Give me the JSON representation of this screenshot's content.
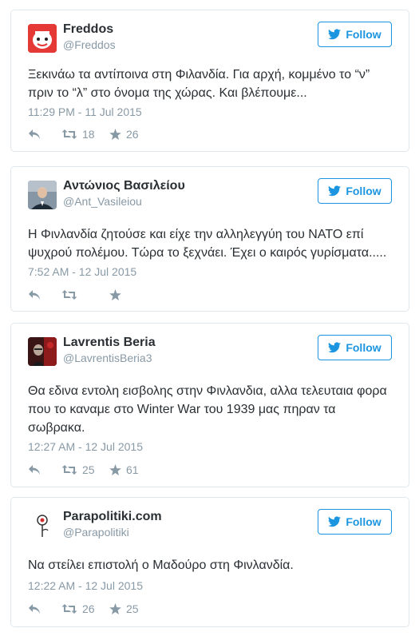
{
  "follow_label": "Follow",
  "tweets": [
    {
      "name": "Freddos",
      "handle": "@Freddos",
      "text_lines": [
        "Ξεκινάω τα αντίποινα στη Φιλανδία. Για αρχή, κομμένο το “ν”",
        "πριν το “λ” στο όνομα της χώρας. Και βλέπουμε..."
      ],
      "date": "11:29 PM - 11 Jul 2015",
      "retweets": "18",
      "likes": "26"
    },
    {
      "name": "Αντώνιος Βασιλείου",
      "handle": "@Ant_Vasileiou",
      "text_lines": [
        "Η Φινλανδία ζητούσε και είχε την αλληλεγγύη του ΝΑΤΟ επί",
        "ψυχρού πολέμου. Τώρα το ξεχνάει. Έχει ο καιρός γυρίσματα....."
      ],
      "date": "7:52 AM - 12 Jul 2015",
      "retweets": "",
      "likes": ""
    },
    {
      "name": "Lavrentis Beria",
      "handle": "@LavrentisBeria3",
      "text_lines": [
        "Θα εδινα εντολη εισβολης στην Φινλανδια, αλλα τελευταια φορα",
        "που το καναμε στο Winter War του 1939 μας πηραν τα",
        "σωβρακα."
      ],
      "date": "12:27 AM - 12 Jul 2015",
      "retweets": "25",
      "likes": "61"
    },
    {
      "name": "Parapolitiki.com",
      "handle": "@Parapolitiki",
      "text_lines": [
        "Να στείλει επιστολή ο Μαδούρο στη Φινλανδία."
      ],
      "date": "12:22 AM - 12 Jul 2015",
      "retweets": "26",
      "likes": "25"
    }
  ],
  "colors": {
    "accent": "#1b95e0",
    "muted": "#8899a6",
    "text": "#292f33",
    "border": "#e1e8ed"
  }
}
